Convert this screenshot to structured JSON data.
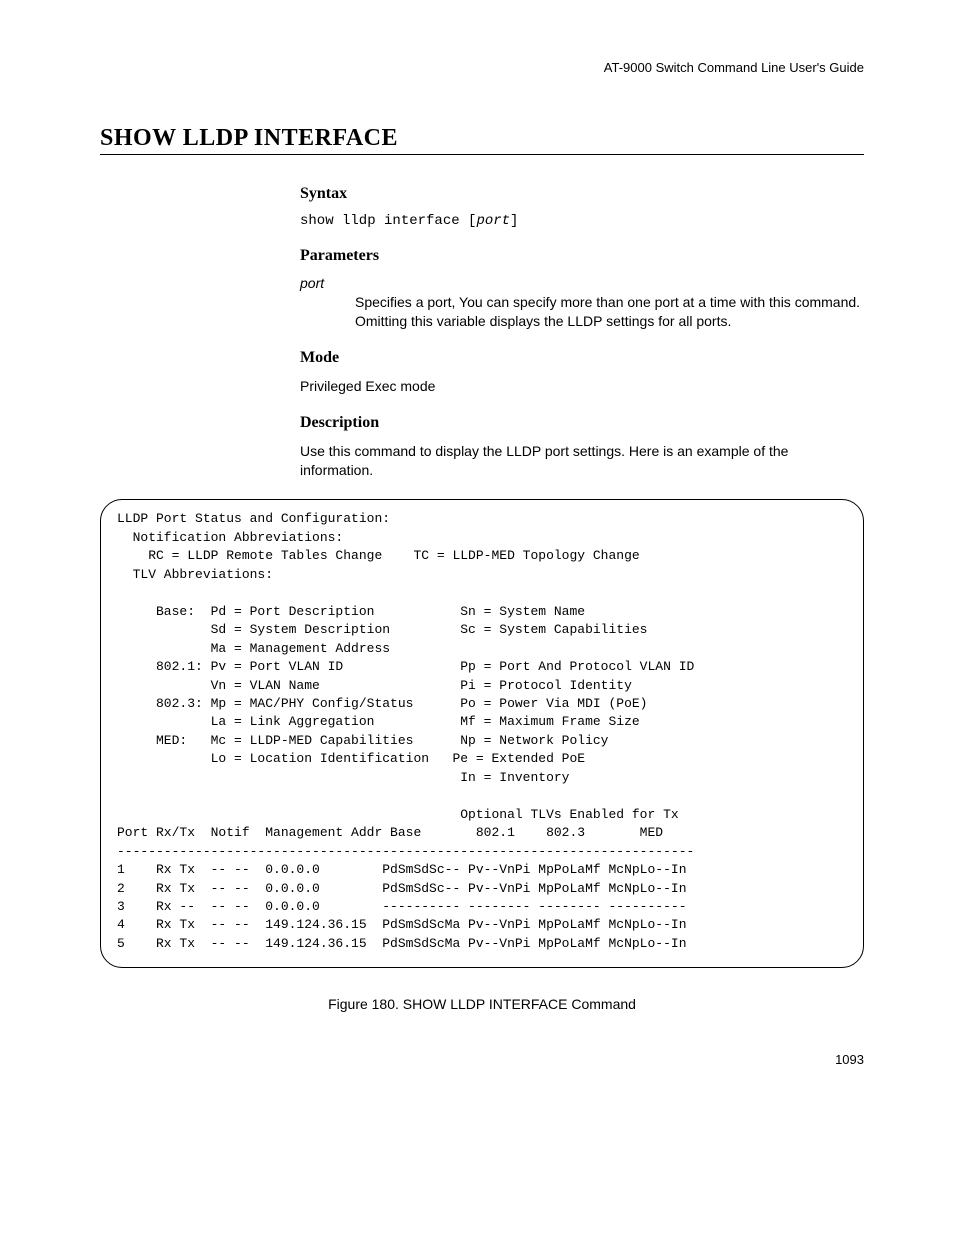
{
  "header": {
    "guide": "AT-9000 Switch Command Line User's Guide"
  },
  "title": "SHOW LLDP INTERFACE",
  "syntax": {
    "heading": "Syntax",
    "prefix": "show lldp interface [",
    "param": "port",
    "suffix": "]"
  },
  "parameters": {
    "heading": "Parameters",
    "param_name": "port",
    "param_desc": "Specifies a port, You can specify more than one port at a time with this command. Omitting this variable displays the LLDP settings for all ports."
  },
  "mode": {
    "heading": "Mode",
    "text": "Privileged Exec mode"
  },
  "description": {
    "heading": "Description",
    "text": "Use this command to display the LLDP port settings. Here is an example of the information."
  },
  "terminal": "LLDP Port Status and Configuration:\n  Notification Abbreviations:\n    RC = LLDP Remote Tables Change    TC = LLDP-MED Topology Change\n  TLV Abbreviations:\n\n     Base:  Pd = Port Description           Sn = System Name\n            Sd = System Description         Sc = System Capabilities\n            Ma = Management Address\n     802.1: Pv = Port VLAN ID               Pp = Port And Protocol VLAN ID\n            Vn = VLAN Name                  Pi = Protocol Identity\n     802.3: Mp = MAC/PHY Config/Status      Po = Power Via MDI (PoE)\n            La = Link Aggregation           Mf = Maximum Frame Size\n     MED:   Mc = LLDP-MED Capabilities      Np = Network Policy\n            Lo = Location Identification   Pe = Extended PoE\n                                            In = Inventory\n\n                                            Optional TLVs Enabled for Tx\nPort Rx/Tx  Notif  Management Addr Base       802.1    802.3       MED\n--------------------------------------------------------------------------\n1    Rx Tx  -- --  0.0.0.0        PdSmSdSc-- Pv--VnPi MpPoLaMf McNpLo--In\n2    Rx Tx  -- --  0.0.0.0        PdSmSdSc-- Pv--VnPi MpPoLaMf McNpLo--In\n3    Rx --  -- --  0.0.0.0        ---------- -------- -------- ----------\n4    Rx Tx  -- --  149.124.36.15  PdSmSdScMa Pv--VnPi MpPoLaMf McNpLo--In\n5    Rx Tx  -- --  149.124.36.15  PdSmSdScMa Pv--VnPi MpPoLaMf McNpLo--In",
  "figure_caption": "Figure 180. SHOW LLDP INTERFACE Command",
  "page_number": "1093"
}
